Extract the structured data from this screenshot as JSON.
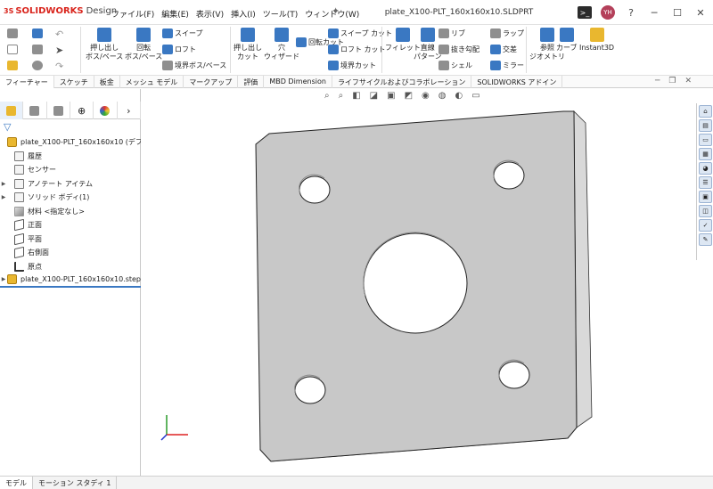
{
  "app": {
    "logo_prefix": "3S",
    "logo_name": "SOLIDWORKS",
    "logo_suffix": "Design",
    "doc_title": "plate_X100-PLT_160x160x10.SLDPRT"
  },
  "menus": [
    "ファイル(F)",
    "編集(E)",
    "表示(V)",
    "挿入(I)",
    "ツール(T)",
    "ウィンドウ(W)"
  ],
  "user_initials": "YH",
  "ribbon": {
    "extrude_boss": "押し出し\nボス/ベース",
    "revolve_boss": "回転\nボス/ベース",
    "sweep": "スイープ",
    "loft": "ロフト",
    "boundary_boss": "境界ボス/ベース",
    "extrude_cut": "押し出し\nカット",
    "hole_wizard": "穴\nウィザード",
    "revolve_cut": "回転カット",
    "sweep_cut": "スイープ カット",
    "loft_cut": "ロフト カット",
    "boundary_cut": "境界カット",
    "fillet": "フィレット",
    "linear_pattern": "直線\nパターン",
    "rib": "リブ",
    "draft": "抜き勾配",
    "shell": "シェル",
    "wrap": "ラップ",
    "intersect": "交差",
    "mirror": "ミラー",
    "ref_geometry": "参照\nジオメトリ",
    "curves": "カーブ",
    "instant3d": "Instant3D"
  },
  "tabs": [
    "フィーチャー",
    "スケッチ",
    "板金",
    "メッシュ モデル",
    "マークアップ",
    "評価",
    "MBD Dimension",
    "ライフサイクルおよびコラボレーション",
    "SOLIDWORKS アドイン"
  ],
  "tree": {
    "part_name": "plate_X100-PLT_160x160x10 (デフォ",
    "history": "履歴",
    "sensors": "センサー",
    "annotations": "アノテート アイテム",
    "solid_bodies": "ソリッド ボディ(1)",
    "material": "材料 <指定なし>",
    "front_plane": "正面",
    "top_plane": "平面",
    "right_plane": "右側面",
    "origin": "原点",
    "imported": "plate_X100-PLT_160x160x10.step<"
  },
  "bottom_tabs": [
    "モデル",
    "モーション スタディ 1"
  ],
  "colors": {
    "accent": "#3a78c2",
    "brand": "#d9251d",
    "part_face": "#c8c8c8"
  }
}
